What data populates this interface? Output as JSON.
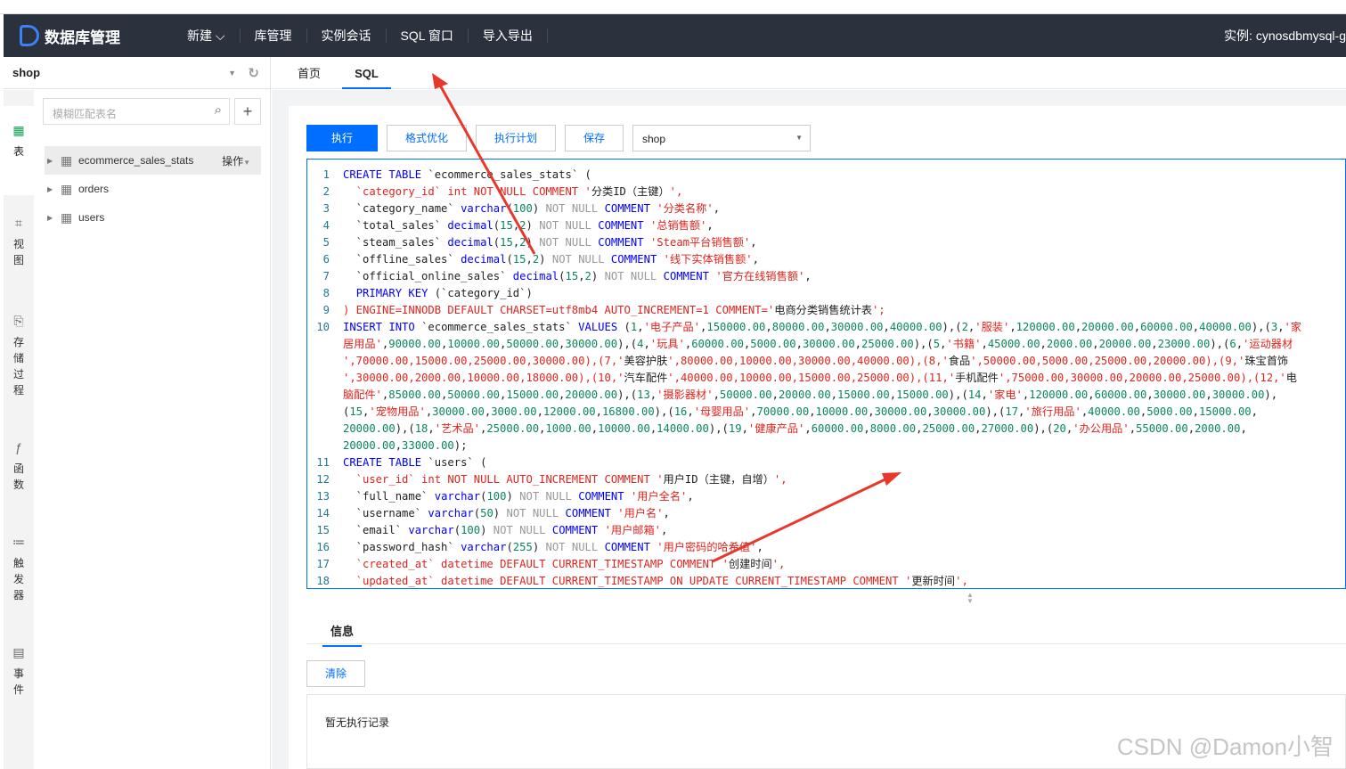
{
  "header": {
    "logo_text": "数据库管理",
    "nav": [
      "新建",
      "库管理",
      "实例会话",
      "SQL 窗口",
      "导入导出"
    ],
    "instance": "实例: cynosdbmysql-g"
  },
  "sidebar": {
    "database": "shop",
    "rail": [
      {
        "label": "表",
        "icon": "table-icon"
      },
      {
        "label": "视图",
        "icon": "view-icon"
      },
      {
        "label": "存储过程",
        "icon": "procedure-icon"
      },
      {
        "label": "函数",
        "icon": "function-icon"
      },
      {
        "label": "触发器",
        "icon": "trigger-icon"
      },
      {
        "label": "事件",
        "icon": "event-icon"
      }
    ],
    "search_placeholder": "模糊匹配表名",
    "tables": [
      "ecommerce_sales_stats",
      "orders",
      "users"
    ],
    "ops_label": "操作"
  },
  "tabs": [
    "首页",
    "SQL"
  ],
  "toolbar": {
    "execute": "执行",
    "format": "格式优化",
    "plan": "执行计划",
    "save": "保存",
    "db": "shop"
  },
  "editor": {
    "rows": [
      {
        "n": "1",
        "t": "CREATE TABLE `ecommerce_sales_stats` ("
      },
      {
        "n": "2",
        "t": "  `category_id` int NOT NULL COMMENT '分类ID（主键）',"
      },
      {
        "n": "3",
        "t": "  `category_name` varchar(100) NOT NULL COMMENT '分类名称',"
      },
      {
        "n": "4",
        "t": "  `total_sales` decimal(15,2) NOT NULL COMMENT '总销售额',"
      },
      {
        "n": "5",
        "t": "  `steam_sales` decimal(15,2) NOT NULL COMMENT 'Steam平台销售额',"
      },
      {
        "n": "6",
        "t": "  `offline_sales` decimal(15,2) NOT NULL COMMENT '线下实体销售额',"
      },
      {
        "n": "7",
        "t": "  `official_online_sales` decimal(15,2) NOT NULL COMMENT '官方在线销售额',"
      },
      {
        "n": "8",
        "t": "  PRIMARY KEY (`category_id`)"
      },
      {
        "n": "9",
        "t": ") ENGINE=INNODB DEFAULT CHARSET=utf8mb4 AUTO_INCREMENT=1 COMMENT='电商分类销售统计表';"
      },
      {
        "n": "10",
        "t": "INSERT INTO `ecommerce_sales_stats` VALUES (1,'电子产品',150000.00,80000.00,30000.00,40000.00),(2,'服装',120000.00,20000.00,60000.00,40000.00),(3,'家"
      },
      {
        "n": "",
        "t": "居用品',90000.00,10000.00,50000.00,30000.00),(4,'玩具',60000.00,5000.00,30000.00,25000.00),(5,'书籍',45000.00,2000.00,20000.00,23000.00),(6,'运动器材"
      },
      {
        "n": "",
        "t": "',70000.00,15000.00,25000.00,30000.00),(7,'美容护肤',80000.00,10000.00,30000.00,40000.00),(8,'食品',50000.00,5000.00,25000.00,20000.00),(9,'珠宝首饰"
      },
      {
        "n": "",
        "t": "',30000.00,2000.00,10000.00,18000.00),(10,'汽车配件',40000.00,10000.00,15000.00,25000.00),(11,'手机配件',75000.00,30000.00,20000.00,25000.00),(12,'电"
      },
      {
        "n": "",
        "t": "脑配件',85000.00,50000.00,15000.00,20000.00),(13,'摄影器材',50000.00,20000.00,15000.00,15000.00),(14,'家电',120000.00,60000.00,30000.00,30000.00),"
      },
      {
        "n": "",
        "t": "(15,'宠物用品',30000.00,3000.00,12000.00,16800.00),(16,'母婴用品',70000.00,10000.00,30000.00,30000.00),(17,'旅行用品',40000.00,5000.00,15000.00,"
      },
      {
        "n": "",
        "t": "20000.00),(18,'艺术品',25000.00,1000.00,10000.00,14000.00),(19,'健康产品',60000.00,8000.00,25000.00,27000.00),(20,'办公用品',55000.00,2000.00,"
      },
      {
        "n": "",
        "t": "20000.00,33000.00);"
      },
      {
        "n": "11",
        "t": "CREATE TABLE `users` ("
      },
      {
        "n": "12",
        "t": "  `user_id` int NOT NULL AUTO_INCREMENT COMMENT '用户ID（主键，自增）',"
      },
      {
        "n": "13",
        "t": "  `full_name` varchar(100) NOT NULL COMMENT '用户全名',"
      },
      {
        "n": "14",
        "t": "  `username` varchar(50) NOT NULL COMMENT '用户名',"
      },
      {
        "n": "15",
        "t": "  `email` varchar(100) NOT NULL COMMENT '用户邮箱',"
      },
      {
        "n": "16",
        "t": "  `password_hash` varchar(255) NOT NULL COMMENT '用户密码的哈希值',"
      },
      {
        "n": "17",
        "t": "  `created_at` datetime DEFAULT CURRENT_TIMESTAMP COMMENT '创建时间',"
      },
      {
        "n": "18",
        "t": "  `updated_at` datetime DEFAULT CURRENT_TIMESTAMP ON UPDATE CURRENT_TIMESTAMP COMMENT '更新时间',"
      }
    ]
  },
  "info": {
    "tab": "信息",
    "clear": "清除",
    "empty": "暂无执行记录"
  },
  "watermark": "CSDN @Damon小智",
  "colors": {
    "accent": "#006eff",
    "nav_bg": "#2b323e",
    "annotation_arrow": "#e8372c"
  }
}
